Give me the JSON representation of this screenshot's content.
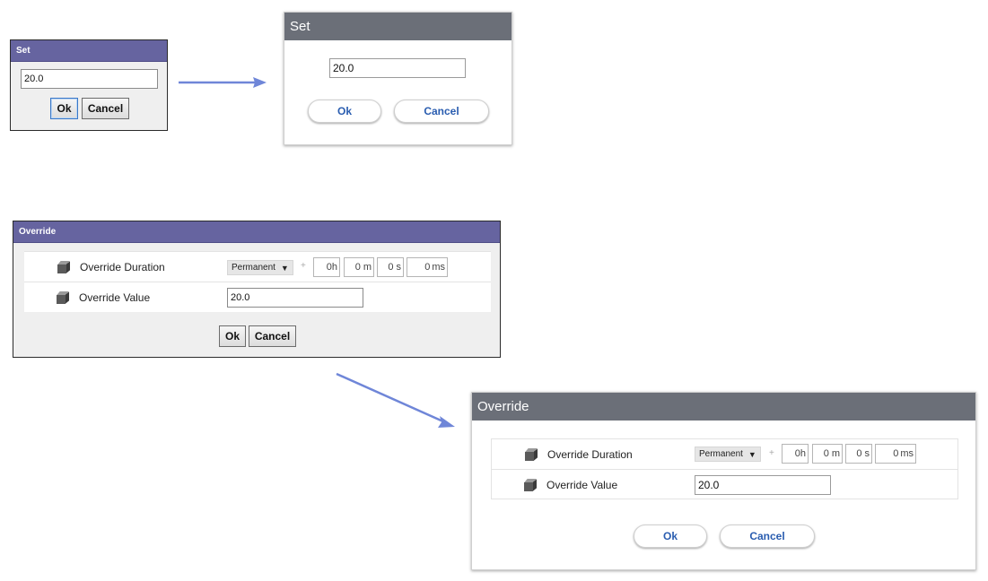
{
  "old_set": {
    "title": "Set",
    "value": "20.0",
    "ok_label": "Ok",
    "cancel_label": "Cancel"
  },
  "new_set": {
    "title": "Set",
    "value": "20.0",
    "ok_label": "Ok",
    "cancel_label": "Cancel"
  },
  "old_override": {
    "title": "Override",
    "duration_label": "Override Duration",
    "duration_mode": "Permanent",
    "plus": "+",
    "hours": "0",
    "hours_unit": "h",
    "minutes": "0",
    "minutes_unit": "m",
    "seconds": "0",
    "seconds_unit": "s",
    "ms": "0",
    "ms_unit": "ms",
    "value_label": "Override Value",
    "value": "20.0",
    "ok_label": "Ok",
    "cancel_label": "Cancel"
  },
  "new_override": {
    "title": "Override",
    "duration_label": "Override Duration",
    "duration_mode": "Permanent",
    "plus": "+",
    "hours": "0",
    "hours_unit": "h",
    "minutes": "0",
    "minutes_unit": "m",
    "seconds": "0",
    "seconds_unit": "s",
    "ms": "0",
    "ms_unit": "ms",
    "value_label": "Override Value",
    "value": "20.0",
    "ok_label": "Ok",
    "cancel_label": "Cancel"
  },
  "colors": {
    "old_title_bar": "#6664a0",
    "new_title_bar": "#6b6f78",
    "arrow": "#6f86d8",
    "pill_text": "#2a5db0"
  },
  "icons": [
    "cube-icon",
    "dropdown-arrow-icon",
    "arrow-right-icon"
  ]
}
